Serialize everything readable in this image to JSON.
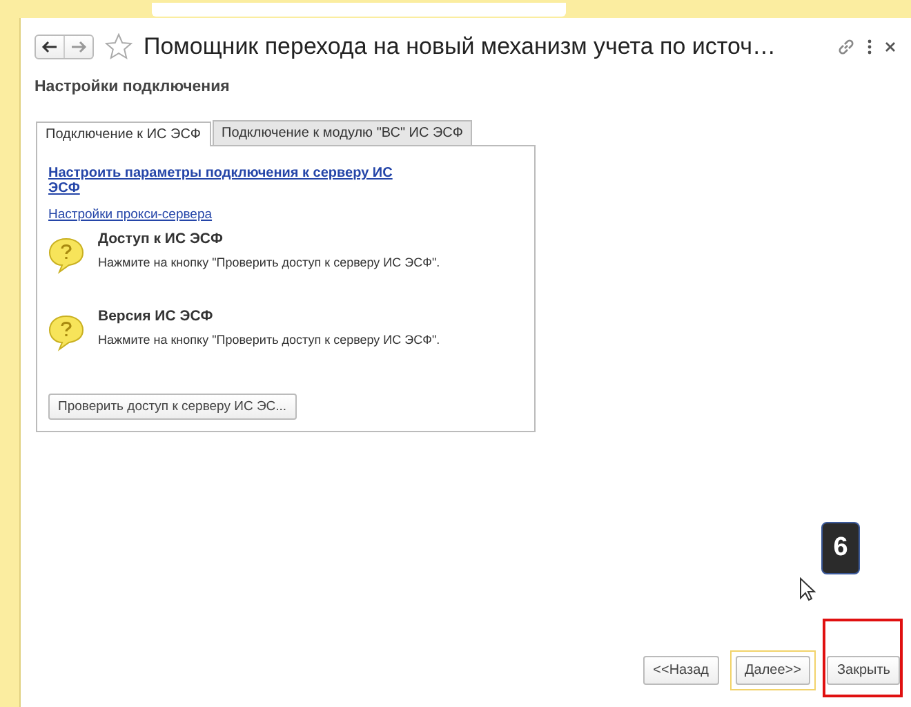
{
  "window": {
    "title": "Помощник перехода на новый механизм учета по источ…"
  },
  "section_title": "Настройки подключения",
  "tabs": [
    {
      "label": "Подключение к ИС ЭСФ",
      "selected": true
    },
    {
      "label": "Подключение к модулю \"ВС\" ИС ЭСФ",
      "selected": false
    }
  ],
  "links": [
    "Настроить параметры подключения к серверу ИС ЭСФ",
    "Настройки прокси-сервера"
  ],
  "statuses": [
    {
      "title": "Доступ к ИС ЭСФ",
      "text": "Нажмите на кнопку \"Проверить доступ к серверу ИС ЭСФ\"."
    },
    {
      "title": "Версия ИС ЭСФ",
      "text": "Нажмите на кнопку \"Проверить доступ к серверу ИС ЭСФ\"."
    }
  ],
  "check_button": "Проверить доступ к серверу ИС ЭС...",
  "step_badge": "6",
  "buttons": [
    {
      "label": "<<Назад",
      "kind": "normal"
    },
    {
      "label": "Далее>>",
      "kind": "default"
    },
    {
      "label": "Закрыть",
      "kind": "highlighted"
    }
  ]
}
